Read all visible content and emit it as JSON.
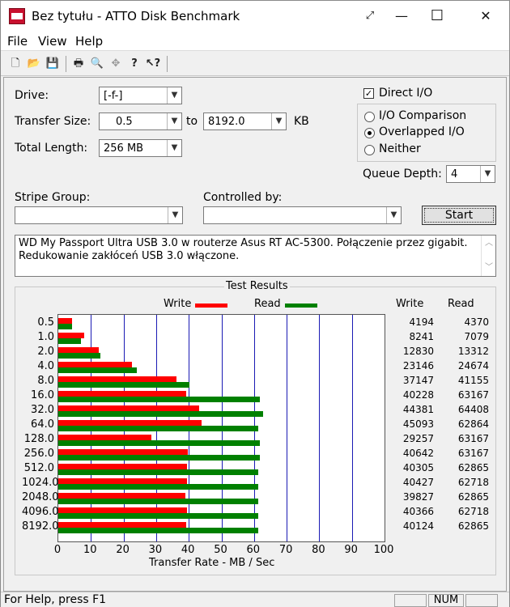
{
  "window": {
    "title": "Bez tytułu - ATTO Disk Benchmark",
    "fullscreen_icon": "⤢",
    "minimize_icon": "—",
    "maximize_icon": "☐",
    "close_icon": "✕"
  },
  "menu": [
    "File",
    "View",
    "Help"
  ],
  "toolbar": [
    "new-icon",
    "open-icon",
    "save-icon",
    "print-icon",
    "print-preview-icon",
    "move-icon",
    "help-icon",
    "context-help-icon"
  ],
  "form": {
    "drive_label": "Drive:",
    "drive_value": "[-f-]",
    "transfer_label": "Transfer Size:",
    "transfer_from": "0.5",
    "to_label": "to",
    "transfer_to": "8192.0",
    "kb_label": "KB",
    "length_label": "Total Length:",
    "length_value": "256 MB",
    "direct_io_label": "Direct I/O",
    "direct_io_checked": true,
    "radio_io_comparison": "I/O Comparison",
    "radio_overlapped": "Overlapped I/O",
    "radio_neither": "Neither",
    "queue_label": "Queue Depth:",
    "queue_value": "4",
    "stripe_label": "Stripe Group:",
    "controlled_label": "Controlled by:",
    "start_label": "Start",
    "description_line1": "WD My Passport Ultra USB 3.0 w routerze Asus RT AC-5300. Połączenie przez gigabit.",
    "description_line2": "Redukowanie zakłóceń USB 3.0 włączone."
  },
  "results": {
    "title": "Test Results",
    "legend_write": "Write",
    "legend_read": "Read",
    "col_write": "Write",
    "col_read": "Read",
    "xlabel": "Transfer Rate - MB / Sec"
  },
  "chart_data": {
    "type": "bar",
    "orientation": "horizontal",
    "categories": [
      "0.5",
      "1.0",
      "2.0",
      "4.0",
      "8.0",
      "16.0",
      "32.0",
      "64.0",
      "128.0",
      "256.0",
      "512.0",
      "1024.0",
      "2048.0",
      "4096.0",
      "8192.0"
    ],
    "series": [
      {
        "name": "Write",
        "color": "#ff0000",
        "values": [
          4.2,
          8.0,
          12.5,
          22.6,
          36.3,
          39.3,
          43.3,
          44.0,
          28.6,
          39.7,
          39.4,
          39.5,
          38.9,
          39.4,
          39.2
        ]
      },
      {
        "name": "Read",
        "color": "#008000",
        "values": [
          4.3,
          6.9,
          13.0,
          24.1,
          40.2,
          61.7,
          62.9,
          61.4,
          61.7,
          61.7,
          61.4,
          61.2,
          61.4,
          61.2,
          61.4
        ]
      }
    ],
    "table_write": [
      "4194",
      "8241",
      "12830",
      "23146",
      "37147",
      "40228",
      "44381",
      "45093",
      "29257",
      "40642",
      "40305",
      "40427",
      "39827",
      "40366",
      "40124"
    ],
    "table_read": [
      "4370",
      "7079",
      "13312",
      "24674",
      "41155",
      "63167",
      "64408",
      "62864",
      "63167",
      "63167",
      "62865",
      "62718",
      "62865",
      "62718",
      "62865"
    ],
    "xticks": [
      "0",
      "10",
      "20",
      "30",
      "40",
      "50",
      "60",
      "70",
      "80",
      "90",
      "100"
    ],
    "xlim": [
      0,
      100
    ],
    "grid": true
  },
  "status": {
    "help_text": "For Help, press F1",
    "num": "NUM"
  }
}
